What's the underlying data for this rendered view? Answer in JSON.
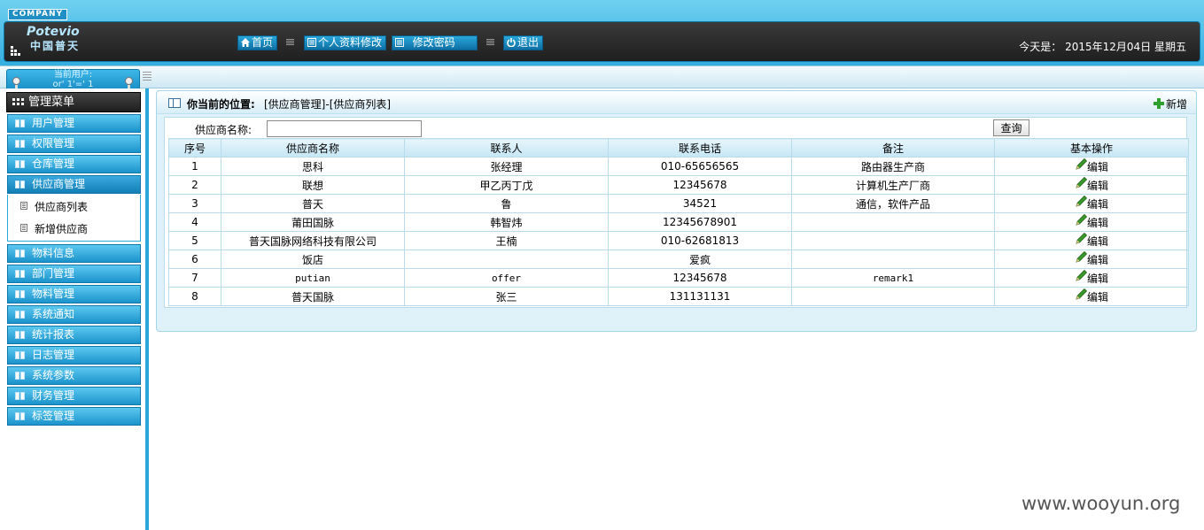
{
  "header": {
    "company_tag": "COMPANY",
    "logo_en": "Potevio",
    "logo_cn": "中国普天",
    "nav": [
      {
        "label": "首页",
        "icon": "home-icon"
      },
      {
        "label": "个人资料修改",
        "icon": "document-icon"
      },
      {
        "label": "修改密码",
        "icon": "document-icon"
      },
      {
        "label": "退出",
        "icon": "power-icon"
      }
    ],
    "today": "今天是： 2015年12月04日 星期五"
  },
  "user": {
    "line1": "当前用户:",
    "line2": "or' 1'=' 1"
  },
  "sidebar": {
    "menu_title": "管理菜单",
    "items": [
      {
        "label": "用户管理"
      },
      {
        "label": "权限管理"
      },
      {
        "label": "仓库管理"
      },
      {
        "label": "供应商管理"
      },
      {
        "label": "物料信息"
      },
      {
        "label": "部门管理"
      },
      {
        "label": "物料管理"
      },
      {
        "label": "系统通知"
      },
      {
        "label": "统计报表"
      },
      {
        "label": "日志管理"
      },
      {
        "label": "系统参数"
      },
      {
        "label": "财务管理"
      },
      {
        "label": "标签管理"
      }
    ],
    "submenu": [
      {
        "label": "供应商列表"
      },
      {
        "label": "新增供应商"
      }
    ]
  },
  "main": {
    "location_label": "你当前的位置:",
    "location_value": "[供应商管理]-[供应商列表]",
    "add_label": "新增",
    "search": {
      "label": "供应商名称:",
      "value": "",
      "button": "查询"
    },
    "table": {
      "columns": [
        "序号",
        "供应商名称",
        "联系人",
        "联系电话",
        "备注",
        "基本操作"
      ],
      "rows": [
        [
          "1",
          "思科",
          "张经理",
          "010-65656565",
          "路由器生产商",
          "编辑"
        ],
        [
          "2",
          "联想",
          "甲乙丙丁戊",
          "12345678",
          "计算机生产厂商",
          "编辑"
        ],
        [
          "3",
          "普天",
          "鲁",
          "34521",
          "通信，软件产品",
          "编辑"
        ],
        [
          "4",
          "莆田国脉",
          "韩智炜",
          "12345678901",
          "",
          "编辑"
        ],
        [
          "5",
          "普天国脉网络科技有限公司",
          "王楠",
          "010-62681813",
          "",
          "编辑"
        ],
        [
          "6",
          "饭店",
          "",
          "爱疯",
          "",
          "编辑"
        ],
        [
          "7",
          "putian",
          "offer",
          "12345678",
          "remark1",
          "编辑"
        ],
        [
          "8",
          "普天国脉",
          "张三",
          "131131131",
          "",
          "编辑"
        ]
      ]
    }
  },
  "watermark": "www.wooyun.org",
  "colors": {
    "accent": "#2ba6da",
    "header_dark": "#2a2a2a",
    "menu_blue": "#1c93cc",
    "add_green": "#2fa02f",
    "pencil_green": "#3a9a2a"
  }
}
